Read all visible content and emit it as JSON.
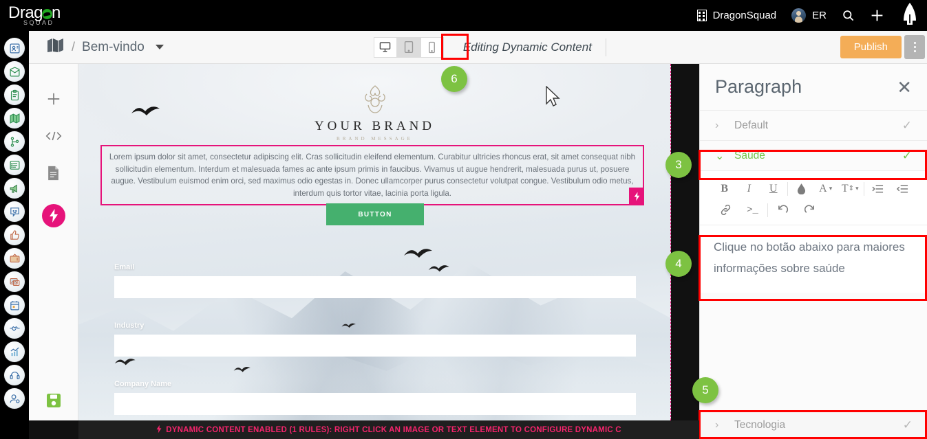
{
  "topbar": {
    "logo_main": "Drag n",
    "logo_letter_pre": "Drag",
    "logo_letter_post": "n",
    "logo_sub": "SQUAD",
    "org_name": "DragonSquad",
    "user_initials": "ER",
    "icons": [
      "building-icon",
      "avatar",
      "search-icon",
      "plus-icon",
      "rocket-icon"
    ]
  },
  "subbar": {
    "breadcrumb_sep": "/",
    "page_name": "Bem-vindo",
    "devices": [
      {
        "name": "desktop",
        "selected": false
      },
      {
        "name": "tablet",
        "selected": true
      },
      {
        "name": "mobile",
        "selected": false
      }
    ],
    "editing_label": "Editing Dynamic Content",
    "publish_label": "Publish"
  },
  "rail": {
    "items": [
      {
        "name": "contacts-icon"
      },
      {
        "name": "email-icon"
      },
      {
        "name": "clipboard-icon"
      },
      {
        "name": "map-icon"
      },
      {
        "name": "workflow-icon"
      },
      {
        "name": "list-icon"
      },
      {
        "name": "megaphone-icon"
      },
      {
        "name": "chat-smile-icon"
      },
      {
        "name": "thumbs-up-icon"
      },
      {
        "name": "tv-icon"
      },
      {
        "name": "media-icon"
      },
      {
        "name": "calendar-icon"
      },
      {
        "name": "handshake-icon"
      },
      {
        "name": "analytics-icon"
      },
      {
        "name": "headset-icon"
      },
      {
        "name": "user-settings-icon"
      }
    ]
  },
  "toolcol": {
    "items": [
      "add-icon",
      "code-icon",
      "document-icon",
      "dynamic-content-bolt-icon"
    ],
    "save": "save-icon"
  },
  "canvas": {
    "brand_name": "YOUR BRAND",
    "brand_message": "BRAND MESSAGE",
    "paragraph": "Lorem ipsum dolor sit amet, consectetur adipiscing elit. Cras sollicitudin eleifend elementum. Curabitur ultricies rhoncus erat, sit amet consequat nibh sollicitudin elementum. Interdum et malesuada fames ac ante ipsum primis in faucibus. Vivamus ut augue hendrerit, malesuada purus ut, posuere augue. Vestibulum euismod enim orci, sed maximus odio egestas in. Donec ullamcorper purus consectetur volutpat congue. Vestibulum odio metus, interdum quis tortor vitae, lacinia porta ligula.",
    "button_label": "BUTTON",
    "fields": [
      {
        "label": "Email",
        "value": ""
      },
      {
        "label": "Industry",
        "value": ""
      },
      {
        "label": "Company Name",
        "value": ""
      }
    ],
    "accent_pink": "#e6137a",
    "button_green": "#45b06e"
  },
  "panel": {
    "title": "Paragraph",
    "close": "✕",
    "rows": [
      {
        "label": "Default",
        "expanded": false,
        "active": false,
        "chevron": "›",
        "check": "✓"
      },
      {
        "label": "Saúde",
        "expanded": true,
        "active": true,
        "chevron": "⌄",
        "check": "✓"
      },
      {
        "label": "Tecnologia",
        "expanded": false,
        "active": false,
        "chevron": "›",
        "check": "✓"
      }
    ],
    "toolbar_row1": [
      {
        "name": "bold-icon",
        "glyph": "B"
      },
      {
        "name": "italic-icon",
        "glyph": "I"
      },
      {
        "name": "underline-icon",
        "glyph": "U"
      },
      {
        "name": "text-color-icon",
        "glyph": "◆"
      },
      {
        "name": "font-family-icon",
        "glyph": "A"
      },
      {
        "name": "font-size-icon",
        "glyph": "T"
      },
      {
        "name": "indent-increase-icon",
        "glyph": "≣"
      },
      {
        "name": "indent-decrease-icon",
        "glyph": "≣"
      }
    ],
    "toolbar_row2": [
      {
        "name": "link-icon",
        "glyph": "⚭"
      },
      {
        "name": "source-code-icon",
        "glyph": ">_"
      },
      {
        "name": "undo-icon",
        "glyph": "↶"
      },
      {
        "name": "redo-icon",
        "glyph": "↷"
      }
    ],
    "edit_text": "Clique no botão abaixo para maiores informações sobre saúde",
    "active_green": "#72c247"
  },
  "statusbar": {
    "text": "DYNAMIC CONTENT ENABLED (1 RULES): RIGHT CLICK AN IMAGE OR TEXT ELEMENT TO CONFIGURE DYNAMIC C",
    "color": "#f5246c"
  },
  "badges": [
    {
      "number": "3"
    },
    {
      "number": "4"
    },
    {
      "number": "5"
    },
    {
      "number": "6"
    }
  ]
}
